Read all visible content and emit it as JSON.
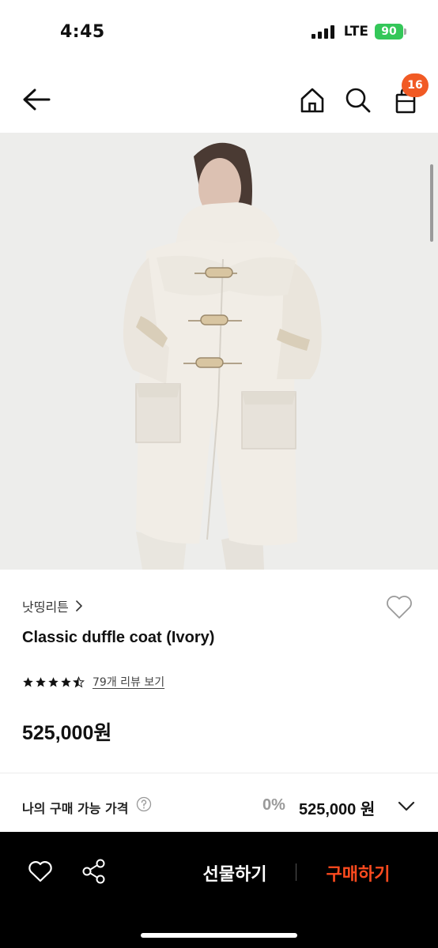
{
  "status_bar": {
    "time": "4:45",
    "network": "LTE",
    "battery": "90"
  },
  "nav": {
    "cart_count": "16"
  },
  "product": {
    "brand": "낫띵리튼",
    "title": "Classic duffle coat (Ivory)",
    "rating": 4.5,
    "review_text": "79개 리뷰 보기",
    "price": "525,000원"
  },
  "my_price": {
    "label": "나의 구매 가능 가격",
    "discount": "0%",
    "value": "525,000 원"
  },
  "bottom_bar": {
    "gift_label": "선물하기",
    "buy_label": "구매하기"
  },
  "colors": {
    "accent": "#f15a24",
    "buy": "#ff4b1f",
    "battery": "#34c759"
  }
}
